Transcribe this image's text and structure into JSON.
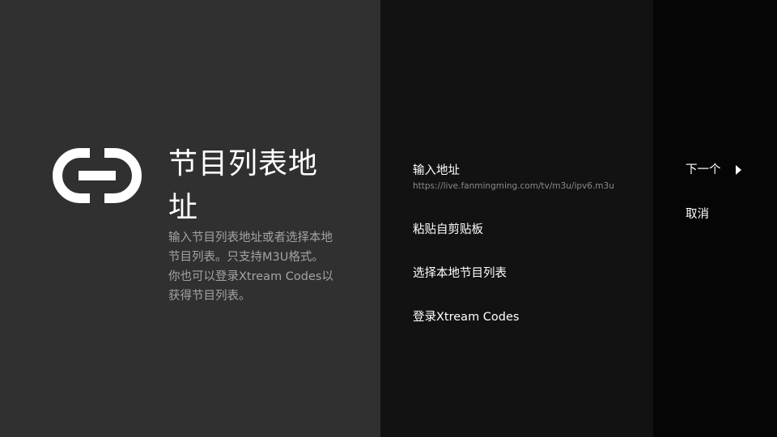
{
  "guidance": {
    "icon": "link-icon",
    "title": "节目列表地址",
    "description": "输入节目列表地址或者选择本地节目列表。只支持M3U格式。你也可以登录Xtream Codes以获得节目列表。"
  },
  "actions": [
    {
      "label": "输入地址",
      "value": "https://live.fanmingming.com/tv/m3u/ipv6.m3u"
    },
    {
      "label": "粘贴自剪贴板"
    },
    {
      "label": "选择本地节目列表"
    },
    {
      "label": "登录Xtream Codes"
    }
  ],
  "guided_buttons": {
    "next": "下一个",
    "cancel": "取消"
  },
  "colors": {
    "left_panel": "#303030",
    "middle_panel": "#121212",
    "right_panel": "#050505",
    "text_primary": "#ffffff",
    "text_secondary": "#a3a3a3"
  }
}
